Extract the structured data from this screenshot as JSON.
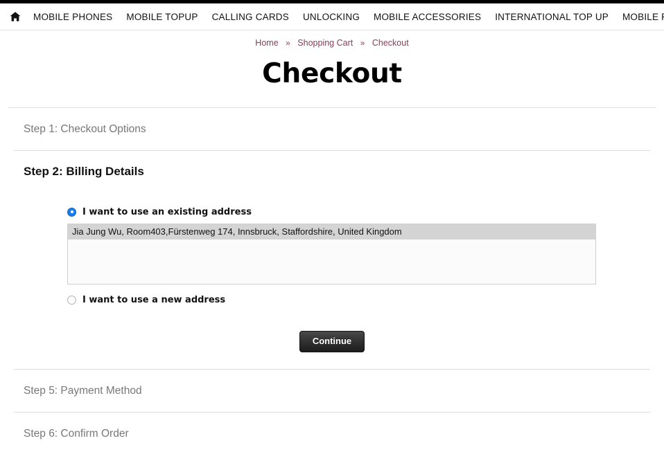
{
  "nav": {
    "home_icon": "home-icon",
    "items": [
      {
        "label": "MOBILE PHONES"
      },
      {
        "label": "MOBILE TOPUP"
      },
      {
        "label": "CALLING CARDS"
      },
      {
        "label": "UNLOCKING"
      },
      {
        "label": "MOBILE ACCESSORIES"
      },
      {
        "label": "INTERNATIONAL TOP UP"
      },
      {
        "label": "MOBILE REPAIRS"
      }
    ]
  },
  "breadcrumb": {
    "items": [
      {
        "label": "Home"
      },
      {
        "label": "Shopping Cart"
      },
      {
        "label": "Checkout"
      }
    ],
    "separator": "»",
    "link_color": "#8c3b57"
  },
  "page": {
    "title": "Checkout"
  },
  "steps": [
    {
      "label": "Step 1: Checkout Options",
      "active": false
    },
    {
      "label": "Step 2: Billing Details",
      "active": true
    },
    {
      "label": "Step 5: Payment Method",
      "active": false
    },
    {
      "label": "Step 6: Confirm Order",
      "active": false
    }
  ],
  "billing": {
    "existing_address_label": "I want to use an existing address",
    "existing_address_selected": true,
    "new_address_label": "I want to use a new address",
    "new_address_selected": false,
    "address_options": [
      {
        "text": "Jia Jung Wu, Room403,Fürstenweg 174, Innsbruck, Staffordshire, United Kingdom",
        "selected": true
      }
    ],
    "continue_label": "Continue"
  },
  "colors": {
    "accent_radio": "#1a7ee8",
    "breadcrumb": "#8c3b57",
    "button_bg": "#333333",
    "option_highlight": "#d4d4d4"
  }
}
